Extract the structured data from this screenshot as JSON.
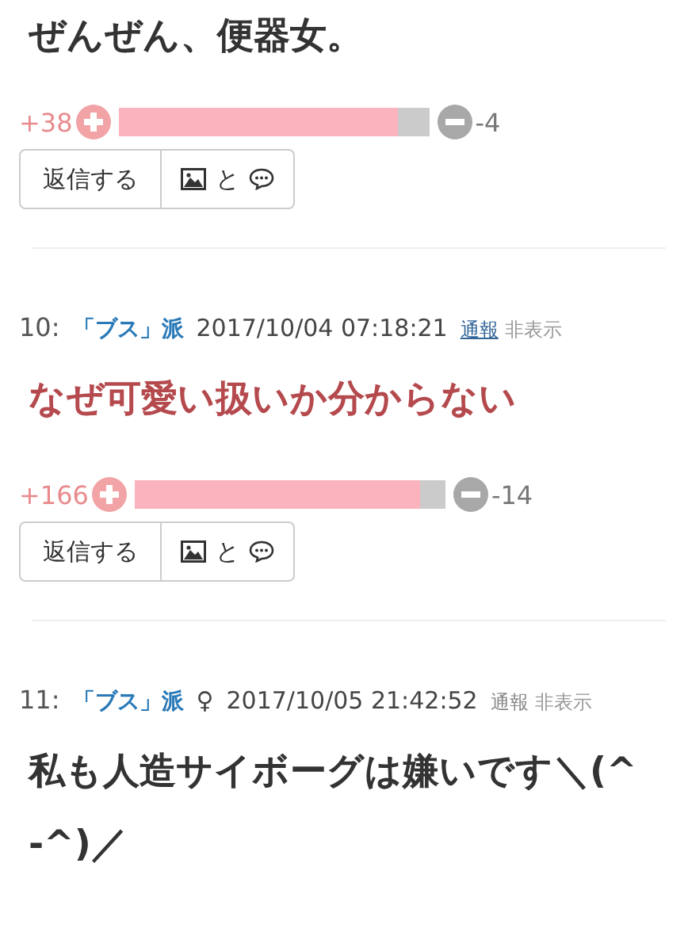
{
  "posts": [
    {
      "body": "ぜんぜん、便器女。",
      "highlighted": false,
      "votes": {
        "plus": "+38",
        "minus": "-4",
        "level": 0.9
      },
      "reply_label": "返信する",
      "attach_joiner": "と"
    },
    {
      "number": "10:",
      "author": "「ブス」派",
      "date": "2017/10/04 07:18:21",
      "report": {
        "label": "通報",
        "active": true
      },
      "hide": "非表示",
      "body": "なぜ可愛い扱いか分からない",
      "highlighted": true,
      "votes": {
        "plus": "+166",
        "minus": "-14",
        "level": 0.92
      },
      "reply_label": "返信する",
      "attach_joiner": "と"
    },
    {
      "number": "11:",
      "author": "「ブス」派",
      "gender": "♀",
      "date": "2017/10/05 21:42:52",
      "report": {
        "label": "通報",
        "active": false
      },
      "hide": "非表示",
      "body": "私も人造サイボーグは嫌いです＼(^-^)／",
      "highlighted": false
    }
  ]
}
